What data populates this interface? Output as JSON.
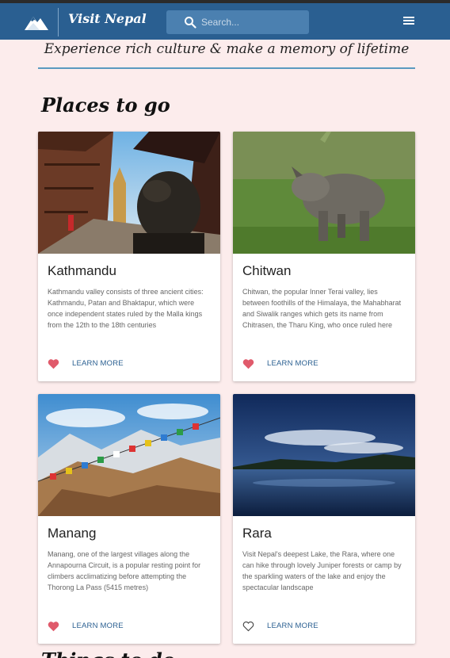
{
  "brand": {
    "name": "Visit Nepal",
    "logo_icon": "mountain-logo-icon"
  },
  "search": {
    "placeholder": "Search...",
    "value": "",
    "icon": "search-icon"
  },
  "menu": {
    "icon": "hamburger-menu-icon"
  },
  "tagline": "Experience rich culture & make a memory of lifetime",
  "sections": {
    "places_title": "Places to go",
    "next_title": "Things to do"
  },
  "colors": {
    "navbar": "#2a5f91",
    "background": "#fcecec",
    "accent_rule": "#5a9ac0",
    "heart": "#e05a6b",
    "link": "#2a5f91"
  },
  "places": [
    {
      "title": "Kathmandu",
      "description": "Kathmandu valley consists of three ancient cities: Kathmandu, Patan and Bhaktapur, which were once independent states ruled by the Malla kings from the 12th to the 18th centuries",
      "cta": "LEARN MORE",
      "favorited": true
    },
    {
      "title": "Chitwan",
      "description": "Chitwan, the popular Inner Terai valley, lies between foothills of the Himalaya, the Mahabharat and Siwalik ranges which gets its name from Chitrasen, the Tharu King, who once ruled here",
      "cta": "LEARN MORE",
      "favorited": true
    },
    {
      "title": "Manang",
      "description": "Manang, one of the largest villages along the Annapourna Circuit, is a popular resting point for climbers acclimatizing before attempting the Thorong La Pass (5415 metres)",
      "cta": "LEARN MORE",
      "favorited": true
    },
    {
      "title": "Rara",
      "description": "Visit Nepal's deepest Lake, the Rara, where one can hike through lovely Juniper forests or camp by the sparkling waters of the lake and enjoy the spectacular landscape",
      "cta": "LEARN MORE",
      "favorited": false
    }
  ]
}
